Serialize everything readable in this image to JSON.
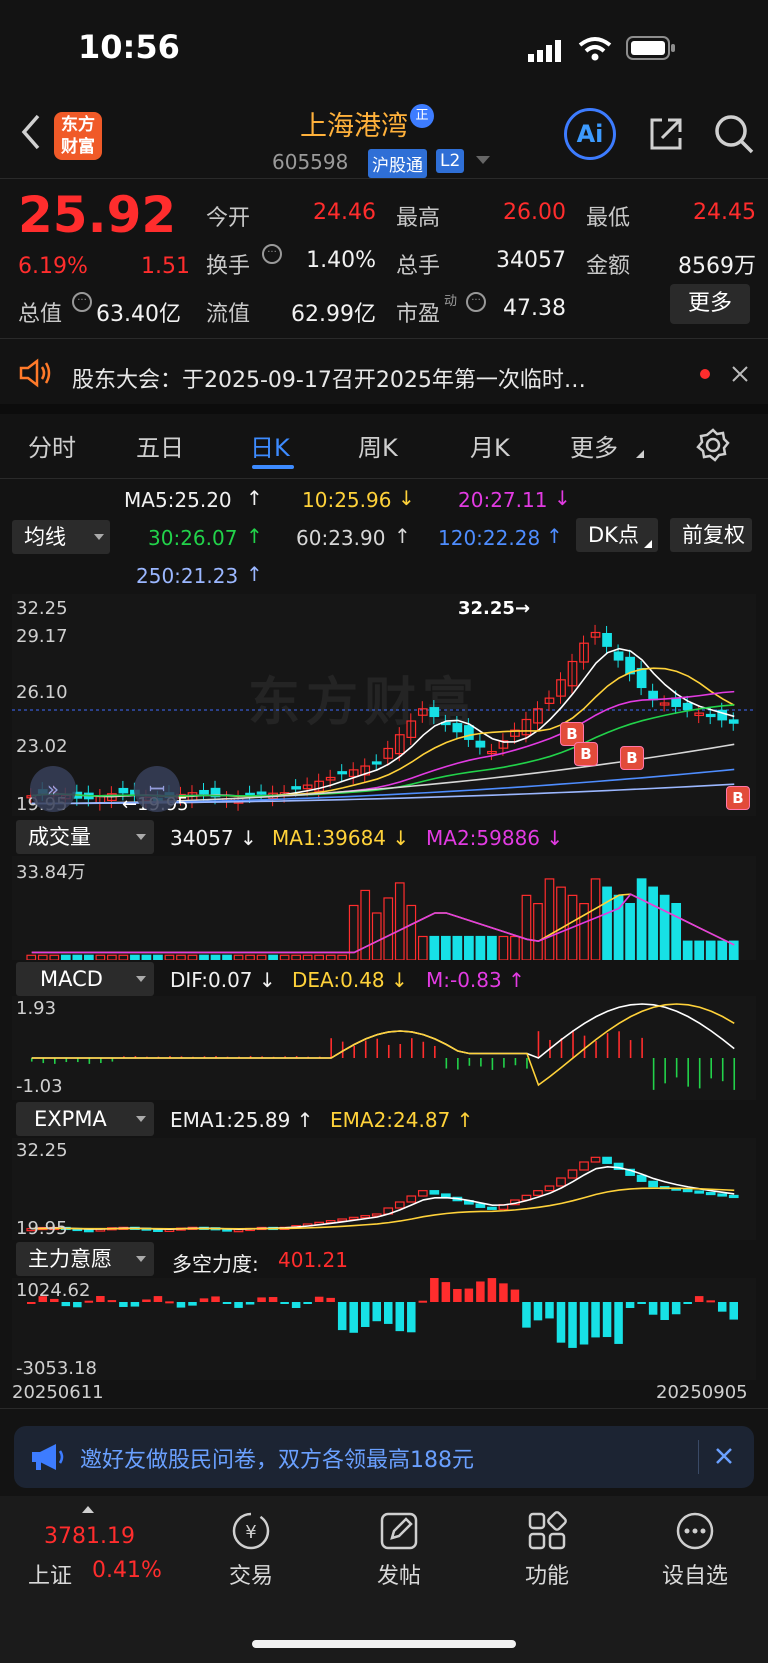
{
  "status": {
    "time": "10:56"
  },
  "header": {
    "logo_text": "东方\n财富",
    "stock_name": "上海港湾",
    "badge": "正",
    "code": "605598",
    "tag1": "沪股通",
    "tag2": "L2",
    "ai_label": "Ai"
  },
  "quote": {
    "price": "25.92",
    "pct": "6.19%",
    "change": "1.51",
    "open_label": "今开",
    "open": "24.46",
    "high_label": "最高",
    "high": "26.00",
    "low_label": "最低",
    "low": "24.45",
    "turnover_label": "换手",
    "turnover": "1.40%",
    "volume_label": "总手",
    "volume": "34057",
    "amount_label": "金额",
    "amount": "8569万",
    "mktcap_label": "总值",
    "mktcap": "63.40亿",
    "float_label": "流值",
    "float_cap": "62.99亿",
    "pe_label": "市盈",
    "pe_sup": "动",
    "pe": "47.38",
    "more": "更多"
  },
  "notice": {
    "text": "股东大会：于2025-09-17召开2025年第一次临时…"
  },
  "tabs": [
    "分时",
    "五日",
    "日K",
    "周K",
    "月K",
    "更多"
  ],
  "ma": {
    "selector": "均线",
    "ma5": "MA5:25.20",
    "ma10": "10:25.96",
    "ma20": "20:27.11",
    "ma30": "30:26.07",
    "ma60": "60:23.90",
    "ma120": "120:22.28",
    "ma250": "250:21.23",
    "dk": "DK点",
    "fq": "前复权"
  },
  "kline": {
    "axis": [
      "32.25",
      "29.17",
      "26.10",
      "23.02"
    ],
    "max_label": "32.25",
    "min_label": "19.95",
    "low_axis": "19.95",
    "b_marker": "B"
  },
  "volume": {
    "selector": "成交量",
    "value": "34057",
    "ma1": "MA1:39684",
    "ma2": "MA2:59886",
    "axis_top": "33.84万"
  },
  "macd": {
    "selector": "MACD",
    "dif": "DIF:0.07",
    "dea": "DEA:0.48",
    "m": "M:-0.83",
    "axis_top": "1.93",
    "axis_bottom": "-1.03"
  },
  "expma": {
    "selector": "EXPMA",
    "ema1": "EMA1:25.89",
    "ema2": "EMA2:24.87",
    "axis_top": "32.25",
    "axis_bottom": "19.95"
  },
  "zlyy": {
    "selector": "主力意愿",
    "label": "多空力度:",
    "value": "401.21",
    "axis_top": "1024.62",
    "axis_bottom": "-3053.18"
  },
  "dates": {
    "start": "20250611",
    "end": "20250905"
  },
  "promo": {
    "text": "邀好友做股民问卷，双方各领最高188元"
  },
  "bottom": {
    "index_value": "3781.19",
    "index_name": "上证",
    "index_pct": "0.41%",
    "nav": [
      "交易",
      "发帖",
      "功能",
      "设自选"
    ]
  }
}
